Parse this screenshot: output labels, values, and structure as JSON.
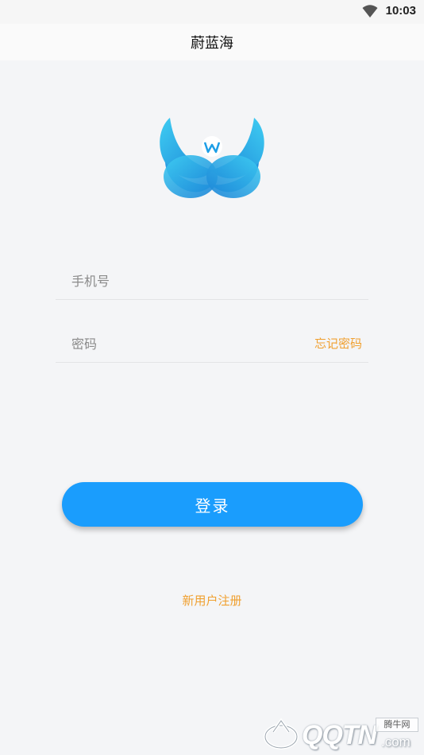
{
  "status_bar": {
    "time": "10:03",
    "wifi_icon": "wifi-icon"
  },
  "app_bar": {
    "title": "蔚蓝海"
  },
  "logo": {
    "icon": "wings-logo-icon",
    "colors": {
      "light": "#35c4f0",
      "dark": "#1d86d8"
    }
  },
  "form": {
    "phone": {
      "placeholder": "手机号",
      "value": ""
    },
    "password": {
      "placeholder": "密码",
      "value": ""
    },
    "forgot_password": "忘记密码"
  },
  "login_button": {
    "label": "登录"
  },
  "register_link": "新用户注册",
  "watermark": {
    "logo_text": "QQTN",
    "domain_suffix": ".com",
    "badge": "腾牛网"
  },
  "colors": {
    "accent": "#1a9dfd",
    "link": "#f0a030",
    "background": "#f4f5f7"
  }
}
